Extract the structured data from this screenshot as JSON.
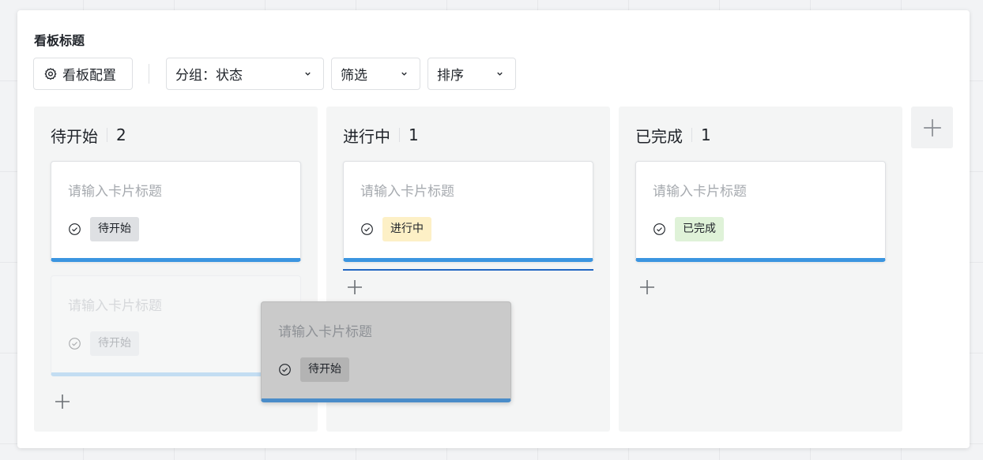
{
  "board": {
    "title": "看板标题"
  },
  "toolbar": {
    "config_label": "看板配置",
    "group_label": "分组：状态",
    "filter_label": "筛选",
    "sort_label": "排序"
  },
  "columns": [
    {
      "name": "待开始",
      "count": "2",
      "cards": [
        {
          "title": "请输入卡片标题",
          "tag": "待开始"
        },
        {
          "title": "请输入卡片标题",
          "tag": "待开始",
          "state": "drag-placeholder"
        }
      ]
    },
    {
      "name": "进行中",
      "count": "1",
      "cards": [
        {
          "title": "请输入卡片标题",
          "tag": "进行中"
        }
      ]
    },
    {
      "name": "已完成",
      "count": "1",
      "cards": [
        {
          "title": "请输入卡片标题",
          "tag": "已完成"
        }
      ]
    }
  ],
  "dragging_card": {
    "title": "请输入卡片标题",
    "tag": "待开始"
  },
  "icons": {
    "config": "gear-icon",
    "dropdown": "chevron-down-icon",
    "status": "check-circle-icon",
    "add": "plus-icon"
  },
  "colors": {
    "card_accent": "#3b95e0",
    "drop_indicator": "#2468c2",
    "tag_todo": "#dee0e3",
    "tag_doing": "#fdf0c6",
    "tag_done": "#dff2d8"
  }
}
